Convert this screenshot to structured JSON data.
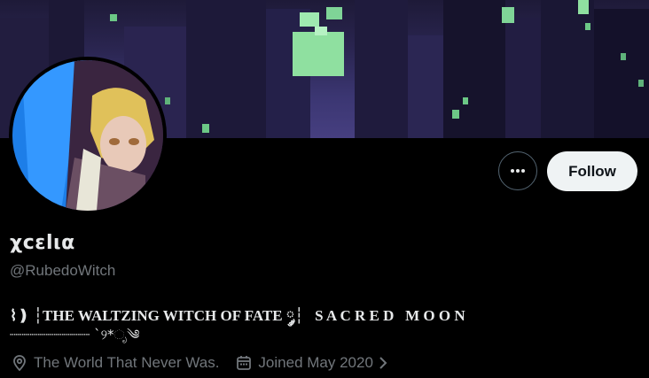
{
  "profile": {
    "display_name": "χcεlια",
    "handle": "@RubedoWitch",
    "bio_line1": "⌇❫ ┆THE WALTZING WITCH OF FATE ༘┆   S A C R E D   M O O N",
    "bio_line2": "┈┈┈┈┈┈┈┈┈┈ ˋ୨*ೃ༄",
    "location": "The World That Never Was.",
    "joined": "Joined May 2020"
  },
  "actions": {
    "follow_label": "Follow"
  },
  "icons": {
    "more": "more-horizontal-icon",
    "location": "location-pin-icon",
    "calendar": "calendar-icon",
    "chevron": "chevron-right-icon"
  },
  "colors": {
    "background": "#000000",
    "primary_text": "#e7e9ea",
    "secondary_text": "#71767b",
    "follow_bg": "#eff3f4",
    "follow_text": "#0f1419",
    "banner_window_green": "#8fe0a0"
  }
}
